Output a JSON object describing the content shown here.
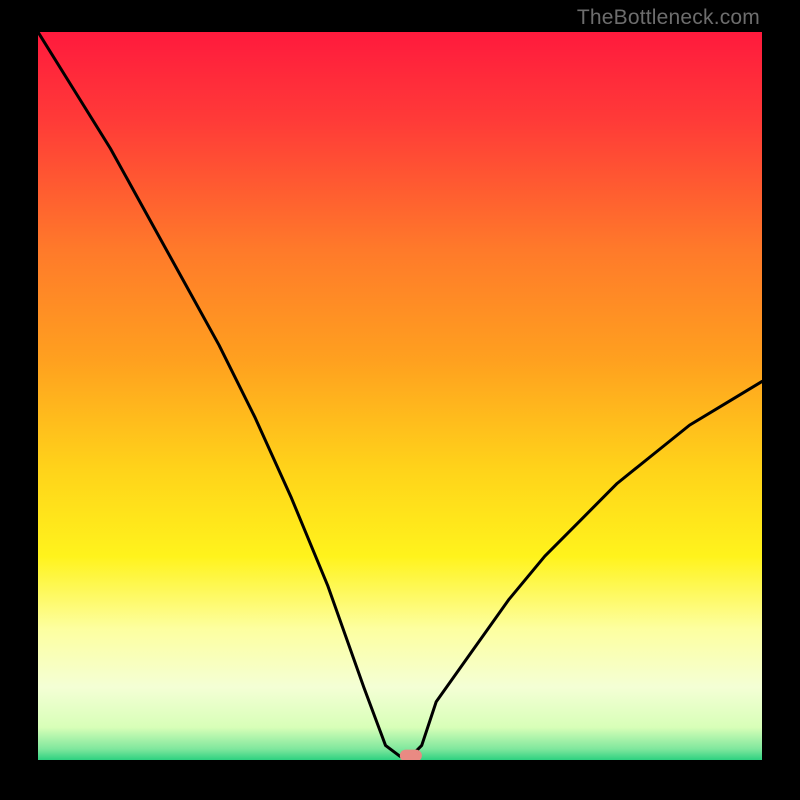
{
  "watermark": "TheBottleneck.com",
  "chart_data": {
    "type": "line",
    "title": "",
    "xlabel": "",
    "ylabel": "",
    "xlim": [
      0,
      100
    ],
    "ylim": [
      0,
      100
    ],
    "grid": false,
    "legend": false,
    "series": [
      {
        "name": "curve",
        "x": [
          0,
          5,
          10,
          15,
          20,
          25,
          30,
          35,
          40,
          45,
          48,
          50,
          51.5,
          53,
          55,
          60,
          65,
          70,
          75,
          80,
          85,
          90,
          95,
          100
        ],
        "y": [
          100,
          92,
          84,
          75,
          66,
          57,
          47,
          36,
          24,
          10,
          2,
          0.5,
          0.5,
          2,
          8,
          15,
          22,
          28,
          33,
          38,
          42,
          46,
          49,
          52
        ]
      }
    ],
    "marker": {
      "x": 51.5,
      "y": 0.6,
      "color": "#e98a83"
    },
    "gradient_stops": [
      {
        "offset": 0.0,
        "color": "#ff1a3d"
      },
      {
        "offset": 0.12,
        "color": "#ff3a38"
      },
      {
        "offset": 0.3,
        "color": "#ff7a2a"
      },
      {
        "offset": 0.45,
        "color": "#ffa01f"
      },
      {
        "offset": 0.6,
        "color": "#ffd31a"
      },
      {
        "offset": 0.72,
        "color": "#fff31c"
      },
      {
        "offset": 0.82,
        "color": "#fdffa0"
      },
      {
        "offset": 0.9,
        "color": "#f4ffd5"
      },
      {
        "offset": 0.955,
        "color": "#d8ffb8"
      },
      {
        "offset": 0.985,
        "color": "#7fe79d"
      },
      {
        "offset": 1.0,
        "color": "#2dd180"
      }
    ]
  }
}
